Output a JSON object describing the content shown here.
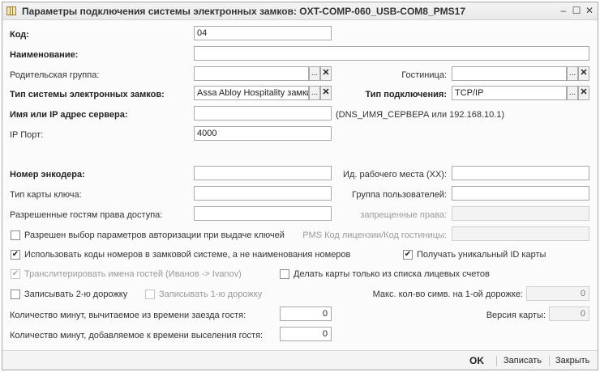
{
  "window": {
    "title": "Параметры подключения системы электронных замков: OXT-COMP-060_USB-COM8_PMS17",
    "minimize": "–",
    "maximize": "☐",
    "close": "✕"
  },
  "form": {
    "code": {
      "label": "Код:",
      "value": "04"
    },
    "name": {
      "label": "Наименование:",
      "value": ""
    },
    "parent_group": {
      "label": "Родительская группа:",
      "value": ""
    },
    "hotel": {
      "label": "Гостиница:",
      "value": ""
    },
    "lock_system_type": {
      "label": "Тип системы электронных замков:",
      "value": "Assa Abloy Hospitality замки"
    },
    "connection_type": {
      "label": "Тип подключения:",
      "value": "TCP/IP"
    },
    "server": {
      "label": "Имя или IP адрес сервера:",
      "value": "",
      "hint": "(DNS_ИМЯ_СЕРВЕРА или 192.168.10.1)"
    },
    "ip_port": {
      "label": "IP Порт:",
      "value": "4000"
    },
    "encoder_number": {
      "label": "Номер энкодера:",
      "value": ""
    },
    "workplace_id": {
      "label": "Ид. рабочего места (XX):",
      "value": ""
    },
    "key_card_type": {
      "label": "Тип карты ключа:",
      "value": ""
    },
    "user_group": {
      "label": "Группа пользователей:",
      "value": ""
    },
    "guest_access_rights": {
      "label": "Разрешенные гостям права доступа:",
      "value": ""
    },
    "forbidden_rights": {
      "label": "запрещенные права:",
      "value": ""
    },
    "allow_auth_params": {
      "label": "Разрешен выбор параметров авторизации при выдаче ключей",
      "checked": false
    },
    "pms_license": {
      "label": "PMS Код лицензии/Код гостиницы:",
      "value": ""
    },
    "use_room_codes": {
      "label": "Использовать коды номеров в замковой системе, а не наименования номеров",
      "checked": true
    },
    "unique_card_id": {
      "label": "Получать уникальный ID карты",
      "checked": true
    },
    "transliterate": {
      "label": "Транслитерировать имена гостей (Иванов -> Ivanov)",
      "checked": true
    },
    "personal_accounts_only": {
      "label": "Делать карты только из списка лицевых счетов",
      "checked": false
    },
    "write_track2": {
      "label": "Записывать 2-ю дорожку",
      "checked": false
    },
    "write_track1": {
      "label": "Записывать 1-ю дорожку",
      "checked": false
    },
    "max_track1_chars": {
      "label": "Макс. кол-во симв. на 1-ой дорожке:",
      "value": "0"
    },
    "minutes_subtract_checkin": {
      "label": "Количество минут, вычитаемое из времени заезда гостя:",
      "value": "0"
    },
    "card_version": {
      "label": "Версия карты:",
      "value": "0"
    },
    "minutes_add_checkout": {
      "label": "Количество минут, добавляемое к времени выселения гостя:",
      "value": "0"
    },
    "select_glyph": "...",
    "clear_glyph": "✕",
    "check_glyph": "✔"
  },
  "footer": {
    "ok": "OK",
    "save": "Записать",
    "close": "Закрыть"
  }
}
